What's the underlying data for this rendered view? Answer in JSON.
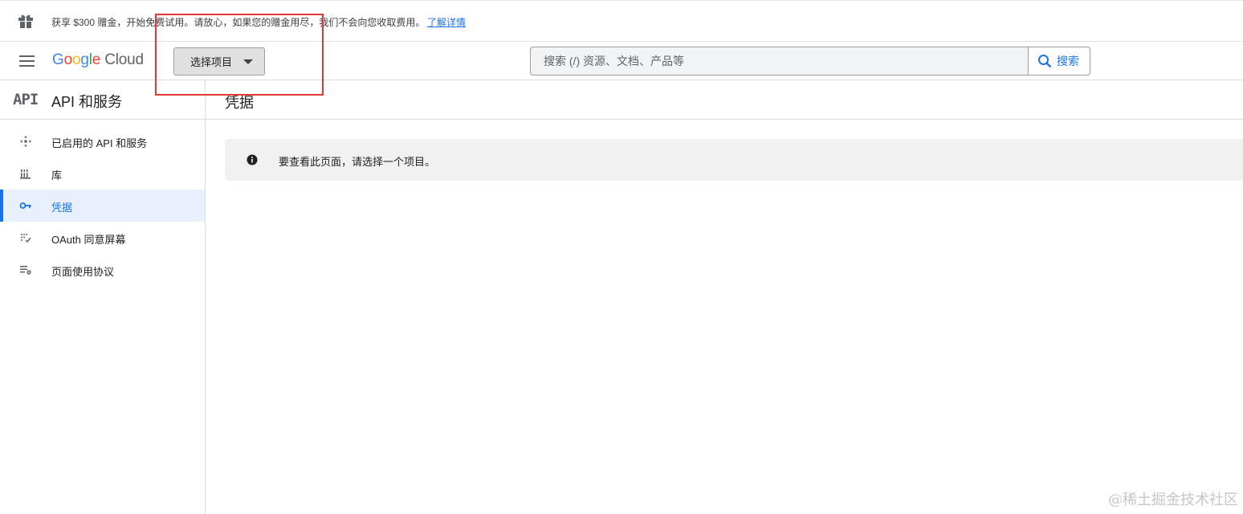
{
  "promo": {
    "text": "获享 $300 赠金，开始免费试用。请放心，如果您的赠金用尽，我们不会向您收取费用。",
    "link": "了解详情"
  },
  "header": {
    "logo_google": [
      "G",
      "o",
      "o",
      "g",
      "l",
      "e"
    ],
    "logo_cloud": "Cloud",
    "project_button": "选择项目",
    "search_placeholder": "搜索 (/) 资源、文档、产品等",
    "search_button": "搜索"
  },
  "sidebar": {
    "api_logo": "API",
    "title": "API 和服务",
    "items": [
      {
        "label": "已启用的 API 和服务",
        "icon": "api-hub-icon",
        "active": false
      },
      {
        "label": "库",
        "icon": "library-icon",
        "active": false
      },
      {
        "label": "凭据",
        "icon": "key-icon",
        "active": true
      },
      {
        "label": "OAuth 同意屏幕",
        "icon": "consent-screen-icon",
        "active": false
      },
      {
        "label": "页面使用协议",
        "icon": "page-settings-icon",
        "active": false
      }
    ]
  },
  "main": {
    "title": "凭据",
    "notice": "要查看此页面，请选择一个项目。"
  },
  "watermark": "@稀土掘金技术社区",
  "colors": {
    "accent": "#1a73e8",
    "highlight_box": "#e53935",
    "notice_bg": "#f1f1f1"
  }
}
